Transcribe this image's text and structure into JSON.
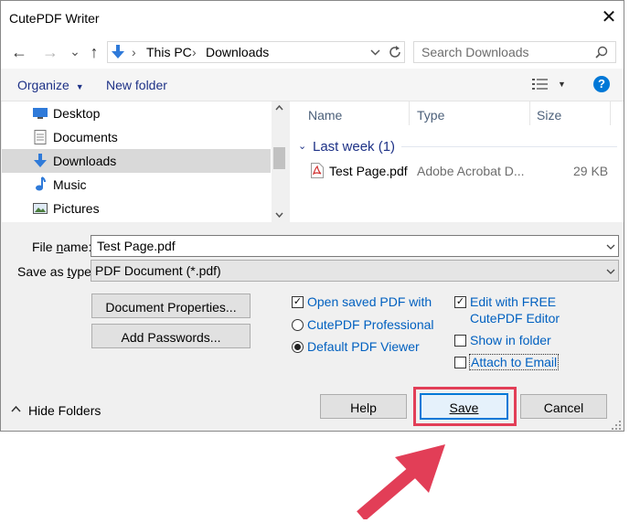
{
  "window": {
    "title": "CutePDF Writer",
    "close_glyph": "✕"
  },
  "nav": {
    "back_glyph": "←",
    "forward_glyph": "→",
    "recent_glyph": "⌄",
    "up_glyph": "↑",
    "breadcrumb": [
      "This PC",
      "Downloads"
    ],
    "separator": "›",
    "search_placeholder": "Search Downloads"
  },
  "toolbar": {
    "organize": "Organize",
    "new_folder": "New folder",
    "help_glyph": "?"
  },
  "sidebar": {
    "items": [
      {
        "label": "Desktop",
        "icon": "desktop-icon",
        "selected": false
      },
      {
        "label": "Documents",
        "icon": "documents-icon",
        "selected": false
      },
      {
        "label": "Downloads",
        "icon": "downloads-icon",
        "selected": true
      },
      {
        "label": "Music",
        "icon": "music-icon",
        "selected": false
      },
      {
        "label": "Pictures",
        "icon": "pictures-icon",
        "selected": false
      }
    ]
  },
  "files": {
    "columns": [
      "Name",
      "Type",
      "Size"
    ],
    "group": "Last week (1)",
    "rows": [
      {
        "name": "Test Page.pdf",
        "type": "Adobe Acrobat D...",
        "size": "29 KB"
      }
    ]
  },
  "form": {
    "file_name_label": "File name:",
    "file_name_value": "Test Page.pdf",
    "save_type_label": "Save as type:",
    "save_type_value": "PDF Document (*.pdf)"
  },
  "options": {
    "doc_props": "Document Properties...",
    "add_passwords": "Add Passwords...",
    "open_saved": "Open saved PDF with",
    "cutepdf_pro": "CutePDF Professional",
    "default_viewer": "Default PDF Viewer",
    "edit_free_1": "Edit with FREE",
    "edit_free_2": "CutePDF Editor",
    "show_folder": "Show in folder",
    "attach_email": "Attach to Email"
  },
  "footer": {
    "hide_folders": "Hide Folders",
    "help": "Help",
    "save": "Save",
    "cancel": "Cancel"
  },
  "colors": {
    "highlight": "#e23e57",
    "accent": "#0078d7",
    "link": "#0060c0"
  }
}
